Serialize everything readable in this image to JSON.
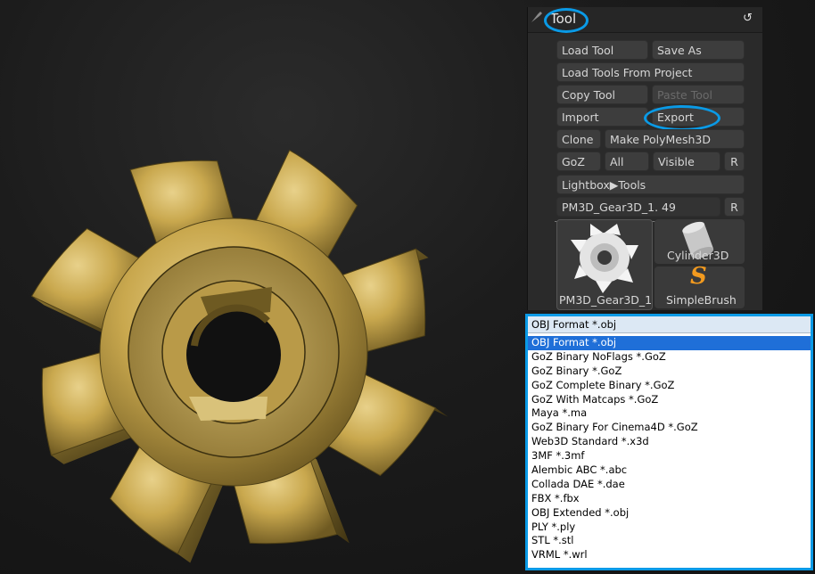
{
  "palette": {
    "title": "Tool",
    "buttons": {
      "load_tool": "Load Tool",
      "save_as": "Save As",
      "load_from_project": "Load Tools From Project",
      "copy_tool": "Copy Tool",
      "paste_tool": "Paste Tool",
      "import": "Import",
      "export": "Export",
      "clone": "Clone",
      "make_polymesh": "Make PolyMesh3D",
      "goz": "GoZ",
      "all": "All",
      "visible": "Visible",
      "r": "R",
      "lightbox": "Lightbox▶Tools"
    },
    "current_tool_field": "PM3D_Gear3D_1. 49",
    "slider_r": "R",
    "thumbnails": {
      "gear_label": "PM3D_Gear3D_1",
      "cylinder_label": "Cylinder3D",
      "simplebrush_label": "SimpleBrush"
    }
  },
  "export_dropdown": {
    "selected": "OBJ Format *.obj",
    "items": [
      "OBJ Format *.obj",
      "GoZ Binary NoFlags *.GoZ",
      "GoZ Binary *.GoZ",
      "GoZ Complete Binary *.GoZ",
      "GoZ With Matcaps *.GoZ",
      "Maya *.ma",
      "GoZ Binary For Cinema4D *.GoZ",
      "Web3D Standard *.x3d",
      "3MF *.3mf",
      "Alembic ABC *.abc",
      "Collada DAE *.dae",
      "FBX *.fbx",
      "OBJ Extended *.obj",
      "PLY *.ply",
      "STL *.stl",
      "VRML *.wrl"
    ],
    "active_index": 0
  },
  "colors": {
    "highlight_ring": "#0a9ae6",
    "accent_orange": "#f08a16",
    "gear_gold": "#c9a84e"
  }
}
